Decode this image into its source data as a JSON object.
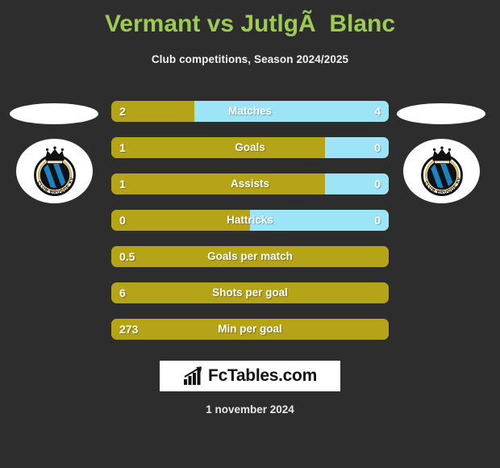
{
  "header": {
    "title": "Vermant vs JutlgÃ  Blanc",
    "subtitle": "Club competitions, Season 2024/2025"
  },
  "colors": {
    "background": "#2d2d2d",
    "title_green": "#9cca55",
    "home_gold": "#b5a318",
    "away_blue": "#9de4f7",
    "text_white": "#ffffff"
  },
  "badges": {
    "home": {
      "name": "Club Brugge KV",
      "crest_text": "CLUB BRUGGE KV"
    },
    "away": {
      "name": "Club Brugge KV",
      "crest_text": "CLUB BRUGGE KV"
    }
  },
  "stats": [
    {
      "label": "Matches",
      "home": "2",
      "away": "4",
      "home_pct": 30,
      "split": true
    },
    {
      "label": "Goals",
      "home": "1",
      "away": "0",
      "home_pct": 77,
      "split": true
    },
    {
      "label": "Assists",
      "home": "1",
      "away": "0",
      "home_pct": 77,
      "split": true
    },
    {
      "label": "Hattricks",
      "home": "0",
      "away": "0",
      "home_pct": 50,
      "split": true
    },
    {
      "label": "Goals per match",
      "home": "0.5",
      "away": "",
      "home_pct": 100,
      "split": false
    },
    {
      "label": "Shots per goal",
      "home": "6",
      "away": "",
      "home_pct": 100,
      "split": false
    },
    {
      "label": "Min per goal",
      "home": "273",
      "away": "",
      "home_pct": 100,
      "split": false
    }
  ],
  "footer": {
    "logo_text": "FcTables.com",
    "date": "1 november 2024"
  }
}
